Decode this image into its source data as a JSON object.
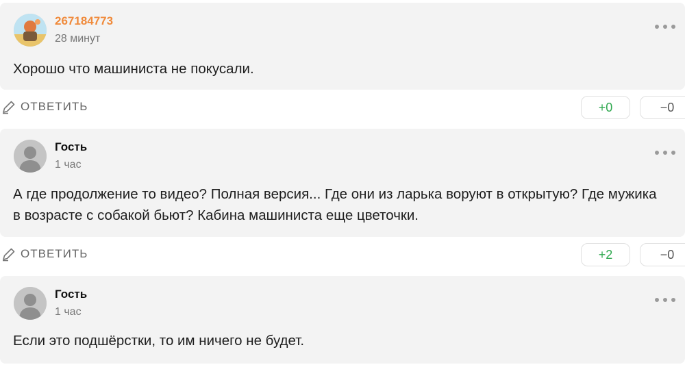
{
  "comments": [
    {
      "author": "267184773",
      "time": "28 минут",
      "text": "Хорошо что машиниста не покусали.",
      "reply_label": "ОТВЕТИТЬ",
      "upvotes": "+0",
      "downvotes": "−0",
      "avatar": "user-illustration-avatar"
    },
    {
      "author": "Гость",
      "time": "1 час",
      "text": "А где продолжение то видео? Полная версия... Где они из ларька воруют в открытую? Где мужика в возрасте с собакой бьют? Кабина машиниста еще цветочки.",
      "reply_label": "ОТВЕТИТЬ",
      "upvotes": "+2",
      "downvotes": "−0",
      "avatar": "default-guest-avatar"
    },
    {
      "author": "Гость",
      "time": "1 час",
      "text": "Если это подшёрстки, то им ничего не будет.",
      "avatar": "default-guest-avatar"
    }
  ],
  "colors": {
    "card_background": "#f3f3f3",
    "author_highlight": "#f08a3b",
    "upvote": "#2fa84f"
  }
}
